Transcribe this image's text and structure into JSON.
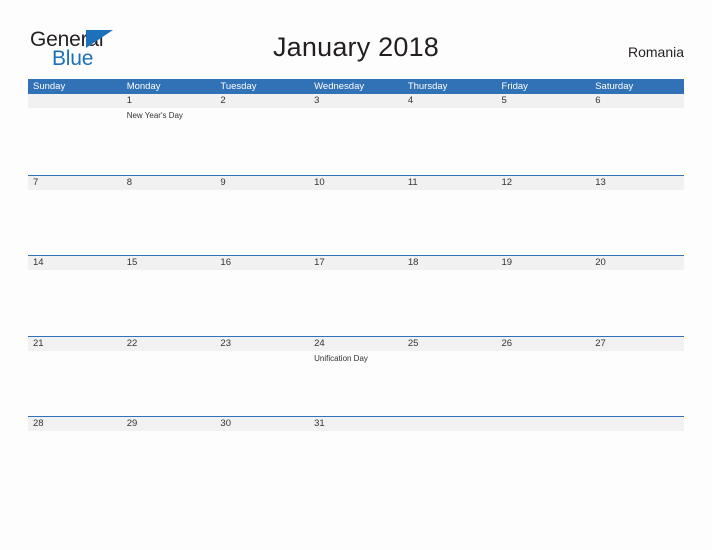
{
  "brand": {
    "name_part1": "General",
    "name_part2": "Blue",
    "flag_icon": "flag-triangle-icon",
    "color_dark": "#231f20",
    "color_blue": "#1d71b8"
  },
  "header": {
    "title": "January 2018",
    "region": "Romania"
  },
  "theme": {
    "header_blue": "#3072b5",
    "band_gray": "#f1f1f1",
    "page_background": "#fdfdfd",
    "text_color": "#333333"
  },
  "calendar": {
    "weekdays": [
      "Sunday",
      "Monday",
      "Tuesday",
      "Wednesday",
      "Thursday",
      "Friday",
      "Saturday"
    ],
    "weeks": [
      {
        "days": [
          {
            "number": "",
            "events": []
          },
          {
            "number": "1",
            "events": [
              "New Year's Day"
            ]
          },
          {
            "number": "2",
            "events": []
          },
          {
            "number": "3",
            "events": []
          },
          {
            "number": "4",
            "events": []
          },
          {
            "number": "5",
            "events": []
          },
          {
            "number": "6",
            "events": []
          }
        ]
      },
      {
        "days": [
          {
            "number": "7",
            "events": []
          },
          {
            "number": "8",
            "events": []
          },
          {
            "number": "9",
            "events": []
          },
          {
            "number": "10",
            "events": []
          },
          {
            "number": "11",
            "events": []
          },
          {
            "number": "12",
            "events": []
          },
          {
            "number": "13",
            "events": []
          }
        ]
      },
      {
        "days": [
          {
            "number": "14",
            "events": []
          },
          {
            "number": "15",
            "events": []
          },
          {
            "number": "16",
            "events": []
          },
          {
            "number": "17",
            "events": []
          },
          {
            "number": "18",
            "events": []
          },
          {
            "number": "19",
            "events": []
          },
          {
            "number": "20",
            "events": []
          }
        ]
      },
      {
        "days": [
          {
            "number": "21",
            "events": []
          },
          {
            "number": "22",
            "events": []
          },
          {
            "number": "23",
            "events": []
          },
          {
            "number": "24",
            "events": [
              "Unification Day"
            ]
          },
          {
            "number": "25",
            "events": []
          },
          {
            "number": "26",
            "events": []
          },
          {
            "number": "27",
            "events": []
          }
        ]
      },
      {
        "days": [
          {
            "number": "28",
            "events": []
          },
          {
            "number": "29",
            "events": []
          },
          {
            "number": "30",
            "events": []
          },
          {
            "number": "31",
            "events": []
          },
          {
            "number": "",
            "events": []
          },
          {
            "number": "",
            "events": []
          },
          {
            "number": "",
            "events": []
          }
        ]
      }
    ]
  }
}
